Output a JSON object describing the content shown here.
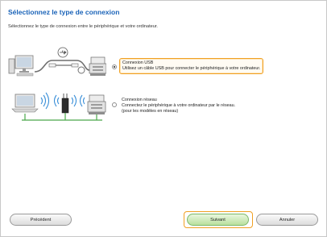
{
  "header": {
    "title": "Sélectionnez le type de connexion",
    "subtitle": "Sélectionnez le type de connexion entre le périphérique et votre ordinateur."
  },
  "options": [
    {
      "title": "Connexion USB",
      "description": "Utilisez un câble USB pour connecter le périphérique à votre ordinateur.",
      "selected": true
    },
    {
      "title": "Connexion réseau",
      "description_line1": "Connectez le périphérique à votre ordinateur par le réseau.",
      "description_line2": "(pour les modèles en réseau)",
      "selected": false
    }
  ],
  "footer": {
    "prev_label": "Précédent",
    "next_label": "Suivant",
    "cancel_label": "Annuler"
  },
  "colors": {
    "title": "#1a63b8",
    "highlight": "#f0a023",
    "next_button": "#b9e09e"
  }
}
